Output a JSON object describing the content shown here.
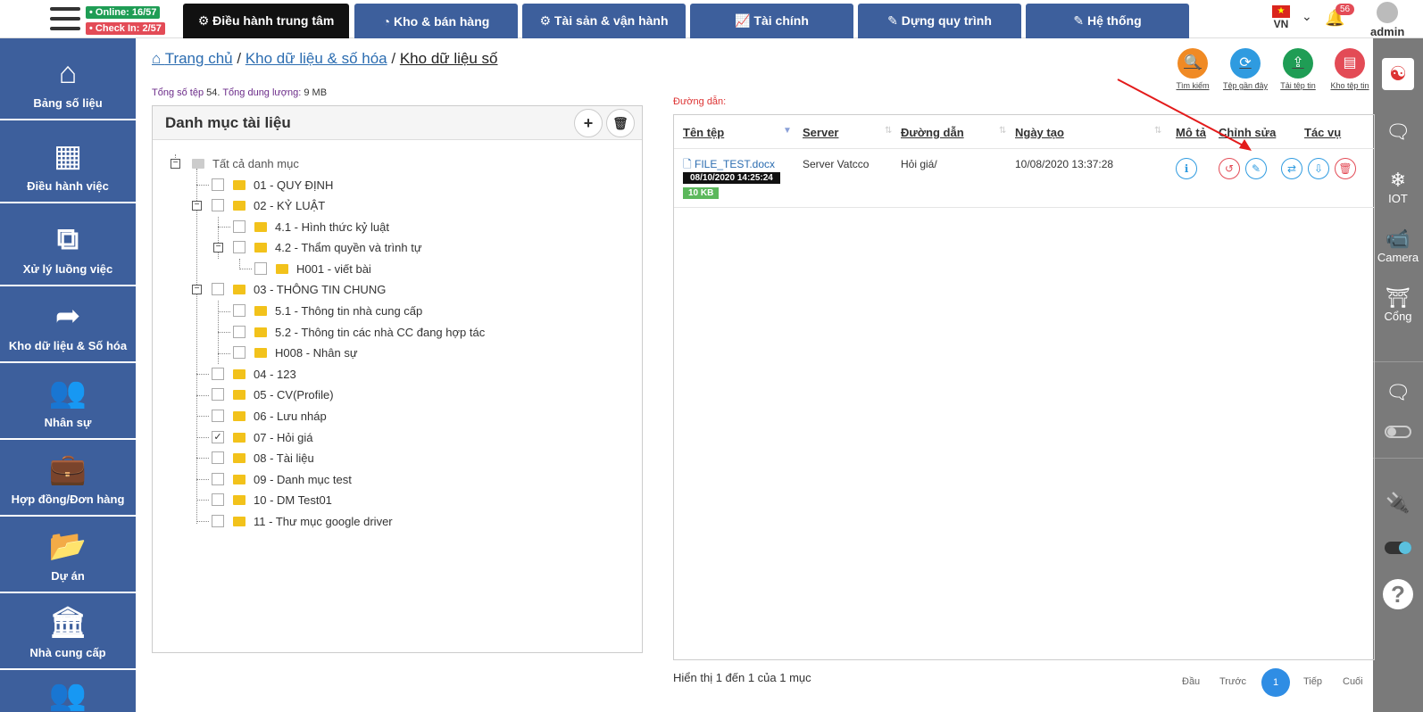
{
  "topbar": {
    "online": "• Online: 16/57",
    "checkin": "• Check In: 2/57",
    "nav": [
      {
        "label": "⚙ Điều hành trung tâm",
        "active": true
      },
      {
        "label": "◔ Kho & bán hàng"
      },
      {
        "label": "⚙ Tài sản & vận hành"
      },
      {
        "label": "📈 Tài chính"
      },
      {
        "label": "✎ Dựng quy trình"
      },
      {
        "label": "✎ Hệ thống"
      }
    ],
    "lang": "VN",
    "notifications": "56",
    "user": "admin"
  },
  "sidebar": {
    "items": [
      {
        "label": "Bảng số liệu",
        "icon": "⌂"
      },
      {
        "label": "Điều hành việc",
        "icon": "▦"
      },
      {
        "label": "Xử lý luồng việc",
        "icon": "⧉"
      },
      {
        "label": "Kho dữ liệu & Số hóa",
        "icon": "➦"
      },
      {
        "label": "Nhân sự",
        "icon": "👥"
      },
      {
        "label": "Hợp đồng/Đơn hàng",
        "icon": "💼"
      },
      {
        "label": "Dự án",
        "icon": "📂"
      },
      {
        "label": "Nhà cung cấp",
        "icon": "🏛"
      },
      {
        "label": "",
        "icon": "👥"
      }
    ]
  },
  "rightbar": {
    "iot": "IOT",
    "camera": "Camera",
    "cong": "Cổng"
  },
  "breadcrumb": {
    "home": "Trang chủ",
    "sep": "/",
    "level1": "Kho dữ liệu & số hóa",
    "current": "Kho dữ liệu số"
  },
  "stats": {
    "files_label": "Tổng số tệp",
    "files_value": "54",
    "size_label": "Tổng dung lượng:",
    "size_value": "9 MB"
  },
  "actions": [
    {
      "label": "Tìm kiếm",
      "icon": "🔍",
      "color": "#f08a24"
    },
    {
      "label": "Tệp gần đây",
      "icon": "⟳",
      "color": "#2f9be0"
    },
    {
      "label": "Tải tệp tin",
      "icon": "⇪",
      "color": "#1f9d55"
    },
    {
      "label": "Kho tệp tin",
      "icon": "▤",
      "color": "#e34b56"
    }
  ],
  "category_panel": {
    "title": "Danh mục tài liệu",
    "add": "+",
    "delete": "🗑",
    "items": [
      {
        "label": "Tất cả danh mục"
      },
      {
        "label": "01 - QUY ĐỊNH"
      },
      {
        "label": "02 - KỶ LUẬT"
      },
      {
        "label": "4.1 - Hình thức kỷ luật"
      },
      {
        "label": "4.2 - Thẩm quyền và trình tự"
      },
      {
        "label": "H001 - viết bài"
      },
      {
        "label": "03 - THÔNG TIN CHUNG"
      },
      {
        "label": "5.1 - Thông tin nhà cung cấp"
      },
      {
        "label": "5.2 - Thông tin các nhà CC đang hợp tác"
      },
      {
        "label": "H008 - Nhân sự"
      },
      {
        "label": "04 - 123"
      },
      {
        "label": "05 - CV(Profile)"
      },
      {
        "label": "06 - Lưu nháp"
      },
      {
        "label": "07 - Hỏi giá",
        "checked": true
      },
      {
        "label": "08 - Tài liệu"
      },
      {
        "label": "09 - Danh mục test"
      },
      {
        "label": "10 - DM Test01"
      },
      {
        "label": "11 - Thư mục google driver"
      }
    ]
  },
  "file_panel": {
    "path_label": "Đường dẫn:",
    "columns": [
      "Tên tệp",
      "Server",
      "Đường dẫn",
      "Ngày tạo",
      "Mô tả",
      "Chỉnh sửa",
      "Tác vụ"
    ],
    "rows": [
      {
        "name": "FILE_TEST.docx",
        "modified": "08/10/2020 14:25:24",
        "size": "10 KB",
        "server": "Server Vatcco",
        "path": "Hỏi giá/",
        "created": "10/08/2020 13:37:28"
      }
    ]
  },
  "footer": {
    "summary": "Hiển thị 1 đến 1 của 1 mục",
    "first": "Đầu",
    "prev": "Trước",
    "current": "1",
    "next": "Tiếp",
    "last": "Cuối"
  },
  "colors": {
    "primary": "#3d5f9c",
    "link": "#2b6cb0",
    "folder": "#f2c21b",
    "badge_green": "#5cb85c"
  }
}
